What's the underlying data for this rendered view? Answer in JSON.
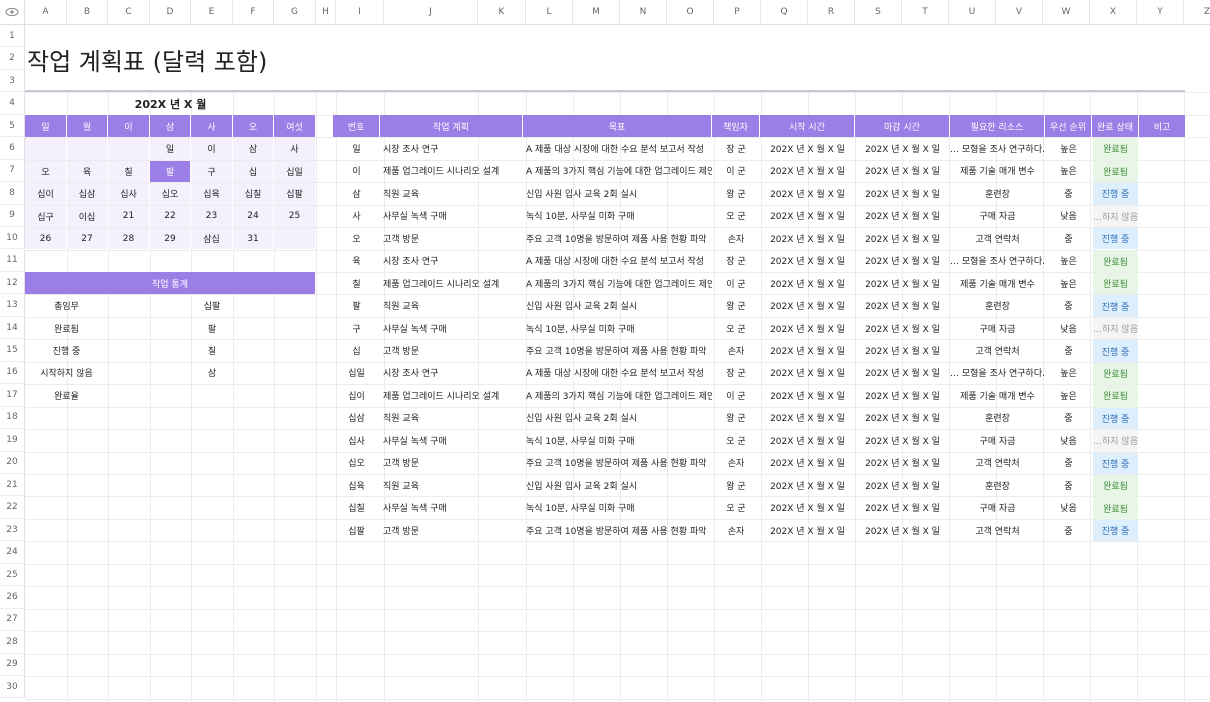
{
  "corner_icon": "eye-icon",
  "column_letters": [
    "A",
    "B",
    "C",
    "D",
    "E",
    "F",
    "G",
    "H",
    "I",
    "J",
    "K",
    "L",
    "M",
    "N",
    "O",
    "P",
    "Q",
    "R",
    "S",
    "T",
    "U",
    "V",
    "W",
    "X",
    "Y",
    "Z",
    "A"
  ],
  "row_numbers": [
    "1",
    "2",
    "3",
    "4",
    "5",
    "6",
    "7",
    "8",
    "9",
    "10",
    "11",
    "12",
    "13",
    "14",
    "15",
    "16",
    "17",
    "18",
    "19",
    "20",
    "21",
    "22",
    "23",
    "24",
    "25",
    "26",
    "27",
    "28",
    "29",
    "30"
  ],
  "title": "작업 계획표 (달력 포함)",
  "calendar": {
    "month_label": "202X 년 X 월",
    "weekdays": [
      "일",
      "월",
      "이",
      "삼",
      "사",
      "오",
      "여섯"
    ],
    "weeks": [
      [
        "",
        "",
        "",
        "일",
        "이",
        "삼",
        "사"
      ],
      [
        "오",
        "육",
        "칠",
        "팔",
        "구",
        "십",
        "십일"
      ],
      [
        "십이",
        "십삼",
        "십사",
        "십오",
        "십육",
        "십칠",
        "십팔"
      ],
      [
        "십구",
        "이십",
        "21",
        "22",
        "23",
        "24",
        "25"
      ],
      [
        "26",
        "27",
        "28",
        "29",
        "삼십",
        "31",
        ""
      ]
    ],
    "highlighted": "팔"
  },
  "stats": {
    "title": "작업 통계",
    "rows": [
      {
        "label": "총임무",
        "value": "십팔"
      },
      {
        "label": "완료됨",
        "value": "팔"
      },
      {
        "label": "진행 중",
        "value": "칠"
      },
      {
        "label": "시작하지 않음",
        "value": "삼"
      },
      {
        "label": "완료율",
        "value": ""
      }
    ]
  },
  "task_table": {
    "headers": [
      "번호",
      "작업 계획",
      "목표",
      "책임자",
      "시작 시간",
      "마감 시간",
      "필요한 리소스",
      "우선 순위",
      "완료 상태",
      "비고"
    ],
    "rows": [
      {
        "no": "일",
        "plan": "시장 조사 연구",
        "goal": "A 제품 대상 시장에 대한 수요 분석 보고서 작성",
        "owner": "장 군",
        "start": "202X 년 X 월 X 일",
        "end": "202X 년 X 월 X 일",
        "res": "… 모형을 조사 연구하다.",
        "pri": "높은",
        "status": "완료됨",
        "kind": "done"
      },
      {
        "no": "이",
        "plan": "제품 업그레이드 시나리오 설계",
        "goal": "A 제품의 3가지 핵심 기능에 대한 업그레이드 제안",
        "owner": "이 군",
        "start": "202X 년 X 월 X 일",
        "end": "202X 년 X 월 X 일",
        "res": "제품 기술 매개 변수",
        "pri": "높은",
        "status": "완료됨",
        "kind": "done"
      },
      {
        "no": "삼",
        "plan": "직원 교육",
        "goal": "신입 사원 입사 교육 2회 실시",
        "owner": "왕 군",
        "start": "202X 년 X 월 X 일",
        "end": "202X 년 X 월 X 일",
        "res": "훈련장",
        "pri": "중",
        "status": "진행 중",
        "kind": "prog"
      },
      {
        "no": "사",
        "plan": "사무실 녹색 구매",
        "goal": "녹식 10분, 사무실 미화 구매",
        "owner": "오 군",
        "start": "202X 년 X 월 X 일",
        "end": "202X 년 X 월 X 일",
        "res": "구매 자금",
        "pri": "낮음",
        "status": "…하지 않음",
        "kind": "none"
      },
      {
        "no": "오",
        "plan": "고객 방문",
        "goal": "주요 고객 10명을 방문하여 제품 사용 현황 파악",
        "owner": "손자",
        "start": "202X 년 X 월 X 일",
        "end": "202X 년 X 월 X 일",
        "res": "고객 연락처",
        "pri": "중",
        "status": "진행 중",
        "kind": "prog"
      },
      {
        "no": "육",
        "plan": "시장 조사 연구",
        "goal": "A 제품 대상 시장에 대한 수요 분석 보고서 작성",
        "owner": "장 군",
        "start": "202X 년 X 월 X 일",
        "end": "202X 년 X 월 X 일",
        "res": "… 모형을 조사 연구하다.",
        "pri": "높은",
        "status": "완료됨",
        "kind": "done"
      },
      {
        "no": "칠",
        "plan": "제품 업그레이드 시나리오 설계",
        "goal": "A 제품의 3가지 핵심 기능에 대한 업그레이드 제안",
        "owner": "이 군",
        "start": "202X 년 X 월 X 일",
        "end": "202X 년 X 월 X 일",
        "res": "제품 기술 매개 변수",
        "pri": "높은",
        "status": "완료됨",
        "kind": "done"
      },
      {
        "no": "팔",
        "plan": "직원 교육",
        "goal": "신입 사원 입사 교육 2회 실시",
        "owner": "왕 군",
        "start": "202X 년 X 월 X 일",
        "end": "202X 년 X 월 X 일",
        "res": "훈련장",
        "pri": "중",
        "status": "진행 중",
        "kind": "prog"
      },
      {
        "no": "구",
        "plan": "사무실 녹색 구매",
        "goal": "녹식 10분, 사무실 미화 구매",
        "owner": "오 군",
        "start": "202X 년 X 월 X 일",
        "end": "202X 년 X 월 X 일",
        "res": "구매 자금",
        "pri": "낮음",
        "status": "…하지 않음",
        "kind": "none"
      },
      {
        "no": "십",
        "plan": "고객 방문",
        "goal": "주요 고객 10명을 방문하여 제품 사용 현황 파악",
        "owner": "손자",
        "start": "202X 년 X 월 X 일",
        "end": "202X 년 X 월 X 일",
        "res": "고객 연락처",
        "pri": "중",
        "status": "진행 중",
        "kind": "prog"
      },
      {
        "no": "십일",
        "plan": "시장 조사 연구",
        "goal": "A 제품 대상 시장에 대한 수요 분석 보고서 작성",
        "owner": "장 군",
        "start": "202X 년 X 월 X 일",
        "end": "202X 년 X 월 X 일",
        "res": "… 모형을 조사 연구하다.",
        "pri": "높은",
        "status": "완료됨",
        "kind": "done"
      },
      {
        "no": "십이",
        "plan": "제품 업그레이드 시나리오 설계",
        "goal": "A 제품의 3가지 핵심 기능에 대한 업그레이드 제안",
        "owner": "이 군",
        "start": "202X 년 X 월 X 일",
        "end": "202X 년 X 월 X 일",
        "res": "제품 기술 매개 변수",
        "pri": "높은",
        "status": "완료됨",
        "kind": "done"
      },
      {
        "no": "십삼",
        "plan": "직원 교육",
        "goal": "신입 사원 입사 교육 2회 실시",
        "owner": "왕 군",
        "start": "202X 년 X 월 X 일",
        "end": "202X 년 X 월 X 일",
        "res": "훈련장",
        "pri": "중",
        "status": "진행 중",
        "kind": "prog"
      },
      {
        "no": "십사",
        "plan": "사무실 녹색 구매",
        "goal": "녹식 10분, 사무실 미화 구매",
        "owner": "오 군",
        "start": "202X 년 X 월 X 일",
        "end": "202X 년 X 월 X 일",
        "res": "구매 자금",
        "pri": "낮음",
        "status": "…하지 않음",
        "kind": "none"
      },
      {
        "no": "십오",
        "plan": "고객 방문",
        "goal": "주요 고객 10명을 방문하여 제품 사용 현황 파악",
        "owner": "손자",
        "start": "202X 년 X 월 X 일",
        "end": "202X 년 X 월 X 일",
        "res": "고객 연락처",
        "pri": "중",
        "status": "진행 중",
        "kind": "prog"
      },
      {
        "no": "십육",
        "plan": "직원 교육",
        "goal": "신입 사원 입사 교육 2회 실시",
        "owner": "왕 군",
        "start": "202X 년 X 월 X 일",
        "end": "202X 년 X 월 X 일",
        "res": "훈련장",
        "pri": "중",
        "status": "완료됨",
        "kind": "done"
      },
      {
        "no": "십칠",
        "plan": "사무실 녹색 구매",
        "goal": "녹식 10분, 사무실 미화 구매",
        "owner": "오 군",
        "start": "202X 년 X 월 X 일",
        "end": "202X 년 X 월 X 일",
        "res": "구매 자금",
        "pri": "낮음",
        "status": "완료됨",
        "kind": "done"
      },
      {
        "no": "십팔",
        "plan": "고객 방문",
        "goal": "주요 고객 10명을 방문하여 제품 사용 현황 파악",
        "owner": "손자",
        "start": "202X 년 X 월 X 일",
        "end": "202X 년 X 월 X 일",
        "res": "고객 연락처",
        "pri": "중",
        "status": "진행 중",
        "kind": "prog"
      }
    ]
  },
  "colors": {
    "header_purple": "#9b7ee6",
    "calendar_bg": "#f4f0fc",
    "done_bg": "#e8f6e6",
    "progress_bg": "#ddeefc"
  }
}
